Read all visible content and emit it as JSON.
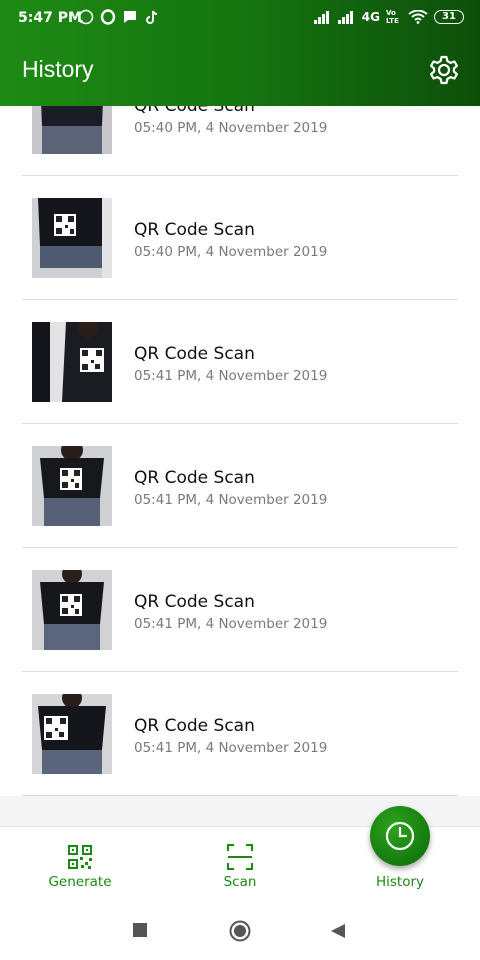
{
  "status_bar": {
    "time": "5:47 PM",
    "network": "4G",
    "volte": "Vo LTE",
    "battery": "31"
  },
  "app_bar": {
    "title": "History",
    "settings_icon": "gear-icon"
  },
  "history": [
    {
      "title": "QR Code Scan",
      "date": "05:40 PM, 4 November 2019"
    },
    {
      "title": "QR Code Scan",
      "date": "05:40 PM, 4 November 2019"
    },
    {
      "title": "QR Code Scan",
      "date": "05:41 PM, 4 November 2019"
    },
    {
      "title": "QR Code Scan",
      "date": "05:41 PM, 4 November 2019"
    },
    {
      "title": "QR Code Scan",
      "date": "05:41 PM, 4 November 2019"
    },
    {
      "title": "QR Code Scan",
      "date": "05:41 PM, 4 November 2019"
    }
  ],
  "bottom_nav": {
    "generate": "Generate",
    "scan": "Scan",
    "history": "History"
  },
  "colors": {
    "brand_green": "#1a8a12",
    "header_dark": "#0d4f0a"
  }
}
